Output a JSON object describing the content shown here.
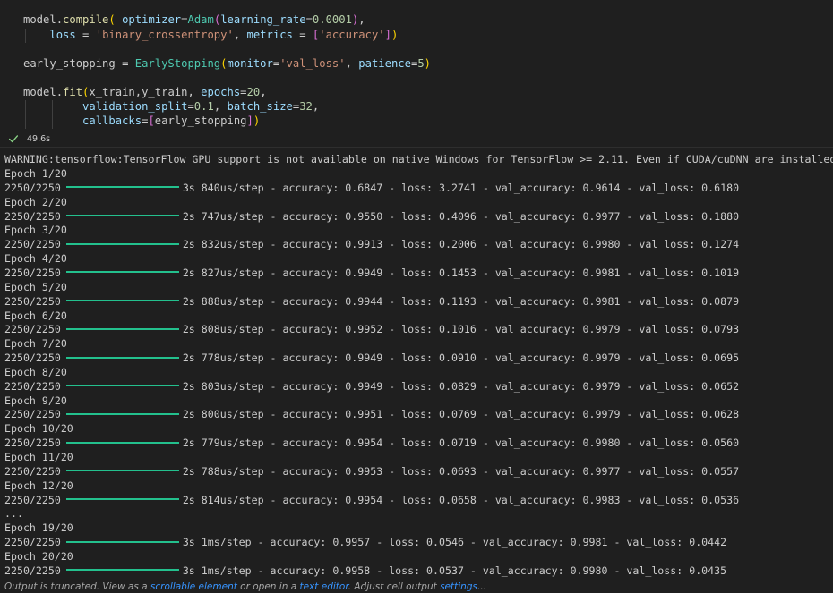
{
  "code": {
    "compile": {
      "model": "model",
      "compile_fn": "compile",
      "optimizer_param": "optimizer",
      "adam_class": "Adam",
      "lr_param": "learning_rate",
      "lr_value": "0.0001",
      "loss_param": "loss",
      "loss_value": "'binary_crossentropy'",
      "metrics_param": "metrics",
      "metrics_value": "'accuracy'"
    },
    "early": {
      "var": "early_stopping",
      "class": "EarlyStopping",
      "monitor_param": "monitor",
      "monitor_value": "'val_loss'",
      "patience_param": "patience",
      "patience_value": "5"
    },
    "fit": {
      "fit_fn": "fit",
      "args1": "x_train,y_train, ",
      "epochs_param": "epochs",
      "epochs_value": "20",
      "vs_param": "validation_split",
      "vs_value": "0.1",
      "bs_param": "batch_size",
      "bs_value": "32",
      "cb_param": "callbacks",
      "cb_value": "early_stopping"
    }
  },
  "execution": {
    "status_icon": "check-icon",
    "time": "49.6s",
    "status_color": "#89d185"
  },
  "output": {
    "warning": "WARNING:tensorflow:TensorFlow GPU support is not available on native Windows for TensorFlow >= 2.11. Even if CUDA/cuDNN are installed, GPU will r",
    "bar_color": "#23c08d",
    "lines": [
      {
        "type": "epoch",
        "text": "Epoch 1/20"
      },
      {
        "type": "step",
        "count": "2250/2250",
        "stats": "3s 840us/step - accuracy: 0.6847 - loss: 3.2741 - val_accuracy: 0.9614 - val_loss: 0.6180"
      },
      {
        "type": "epoch",
        "text": "Epoch 2/20"
      },
      {
        "type": "step",
        "count": "2250/2250",
        "stats": "2s 747us/step - accuracy: 0.9550 - loss: 0.4096 - val_accuracy: 0.9977 - val_loss: 0.1880"
      },
      {
        "type": "epoch",
        "text": "Epoch 3/20"
      },
      {
        "type": "step",
        "count": "2250/2250",
        "stats": "2s 832us/step - accuracy: 0.9913 - loss: 0.2006 - val_accuracy: 0.9980 - val_loss: 0.1274"
      },
      {
        "type": "epoch",
        "text": "Epoch 4/20"
      },
      {
        "type": "step",
        "count": "2250/2250",
        "stats": "2s 827us/step - accuracy: 0.9949 - loss: 0.1453 - val_accuracy: 0.9981 - val_loss: 0.1019"
      },
      {
        "type": "epoch",
        "text": "Epoch 5/20"
      },
      {
        "type": "step",
        "count": "2250/2250",
        "stats": "2s 888us/step - accuracy: 0.9944 - loss: 0.1193 - val_accuracy: 0.9981 - val_loss: 0.0879"
      },
      {
        "type": "epoch",
        "text": "Epoch 6/20"
      },
      {
        "type": "step",
        "count": "2250/2250",
        "stats": "2s 808us/step - accuracy: 0.9952 - loss: 0.1016 - val_accuracy: 0.9979 - val_loss: 0.0793"
      },
      {
        "type": "epoch",
        "text": "Epoch 7/20"
      },
      {
        "type": "step",
        "count": "2250/2250",
        "stats": "2s 778us/step - accuracy: 0.9949 - loss: 0.0910 - val_accuracy: 0.9979 - val_loss: 0.0695"
      },
      {
        "type": "epoch",
        "text": "Epoch 8/20"
      },
      {
        "type": "step",
        "count": "2250/2250",
        "stats": "2s 803us/step - accuracy: 0.9949 - loss: 0.0829 - val_accuracy: 0.9979 - val_loss: 0.0652"
      },
      {
        "type": "epoch",
        "text": "Epoch 9/20"
      },
      {
        "type": "step",
        "count": "2250/2250",
        "stats": "2s 800us/step - accuracy: 0.9951 - loss: 0.0769 - val_accuracy: 0.9979 - val_loss: 0.0628"
      },
      {
        "type": "epoch",
        "text": "Epoch 10/20"
      },
      {
        "type": "step",
        "count": "2250/2250",
        "stats": "2s 779us/step - accuracy: 0.9954 - loss: 0.0719 - val_accuracy: 0.9980 - val_loss: 0.0560"
      },
      {
        "type": "epoch",
        "text": "Epoch 11/20"
      },
      {
        "type": "step",
        "count": "2250/2250",
        "stats": "2s 788us/step - accuracy: 0.9953 - loss: 0.0693 - val_accuracy: 0.9977 - val_loss: 0.0557"
      },
      {
        "type": "epoch",
        "text": "Epoch 12/20"
      },
      {
        "type": "step",
        "count": "2250/2250",
        "stats": "2s 814us/step - accuracy: 0.9954 - loss: 0.0658 - val_accuracy: 0.9983 - val_loss: 0.0536"
      },
      {
        "type": "ellipsis",
        "text": "..."
      },
      {
        "type": "epoch",
        "text": "Epoch 19/20"
      },
      {
        "type": "step",
        "count": "2250/2250",
        "stats": "3s 1ms/step - accuracy: 0.9957 - loss: 0.0546 - val_accuracy: 0.9981 - val_loss: 0.0442"
      },
      {
        "type": "epoch",
        "text": "Epoch 20/20"
      },
      {
        "type": "step",
        "count": "2250/2250",
        "stats": "3s 1ms/step - accuracy: 0.9958 - loss: 0.0537 - val_accuracy: 0.9980 - val_loss: 0.0435"
      }
    ]
  },
  "truncation": {
    "prefix": "Output is truncated. View as a ",
    "link1": "scrollable element",
    "mid": " or open in a ",
    "link2": "text editor",
    "mid2": ". Adjust cell output ",
    "link3": "settings",
    "suffix": "..."
  }
}
